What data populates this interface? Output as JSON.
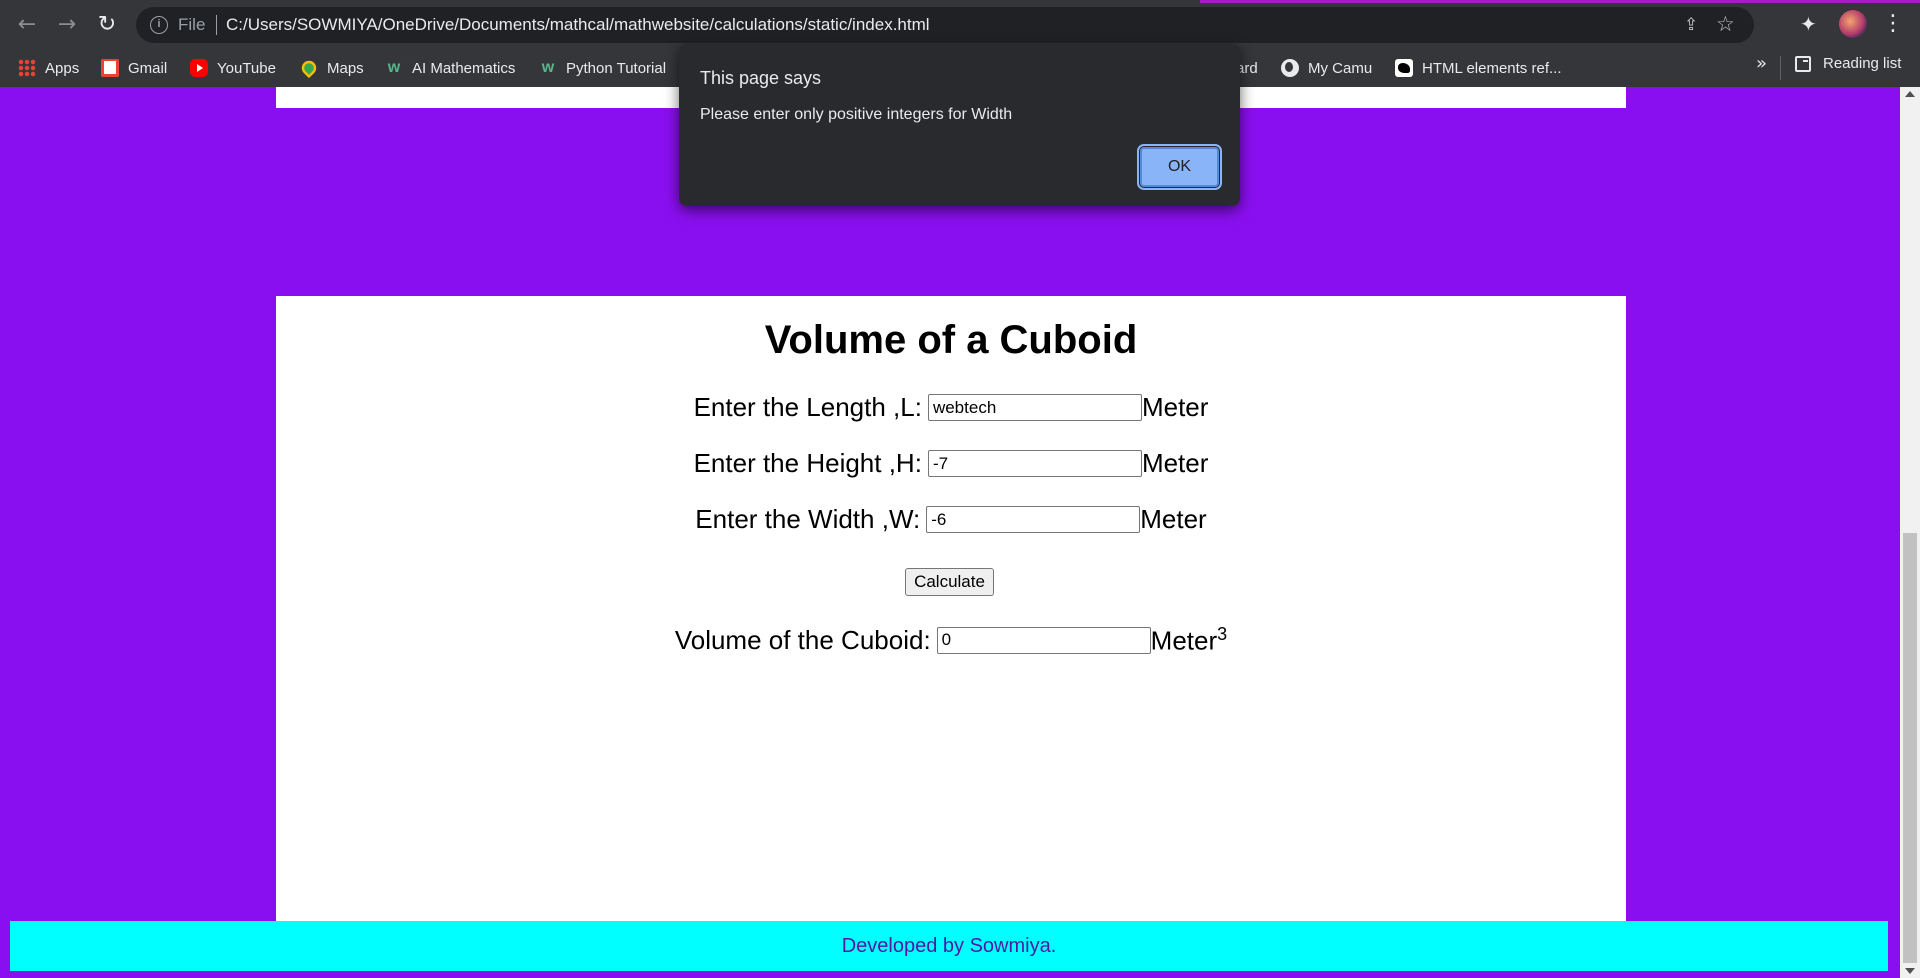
{
  "browser": {
    "scheme": "File",
    "url": "C:/Users/SOWMIYA/OneDrive/Documents/mathcal/mathwebsite/calculations/static/index.html",
    "bookmarks": [
      {
        "label": "Apps",
        "icon": "apps-grid-icon"
      },
      {
        "label": "Gmail",
        "icon": "gmail-icon"
      },
      {
        "label": "YouTube",
        "icon": "youtube-icon"
      },
      {
        "label": "Maps",
        "icon": "maps-pin-icon"
      },
      {
        "label": "AI Mathematics",
        "icon": "w-site-icon"
      },
      {
        "label": "Python Tutorial",
        "icon": "w-site-icon"
      },
      {
        "label": "ard",
        "icon": ""
      },
      {
        "label": "My Camu",
        "icon": "globe-icon"
      },
      {
        "label": "HTML elements ref...",
        "icon": "html-ref-icon"
      }
    ],
    "more_label": "»",
    "reading_list": "Reading list"
  },
  "dialog": {
    "title": "This page says",
    "message": "Please enter only positive integers for Width",
    "ok_label": "OK"
  },
  "form": {
    "title": "Volume of a Cuboid",
    "length_label": "Enter the Length ,L:",
    "length_value": "webtech",
    "height_label": "Enter the Height ,H:",
    "height_value": "-7",
    "width_label": "Enter the Width ,W:",
    "width_value": "-6",
    "unit": "Meter",
    "calculate_label": "Calculate",
    "result_label": "Volume of the Cuboid:",
    "result_value": "0",
    "result_unit": "Meter",
    "result_exponent": "3"
  },
  "footer": {
    "text": "Developed by Sowmiya."
  },
  "colors": {
    "page_bg": "#8a0ff0",
    "footer_bg": "#00ffff",
    "footer_text": "#4b1aa8",
    "dialog_bg": "#292a2d",
    "ok_button": "#8ab4f8"
  }
}
